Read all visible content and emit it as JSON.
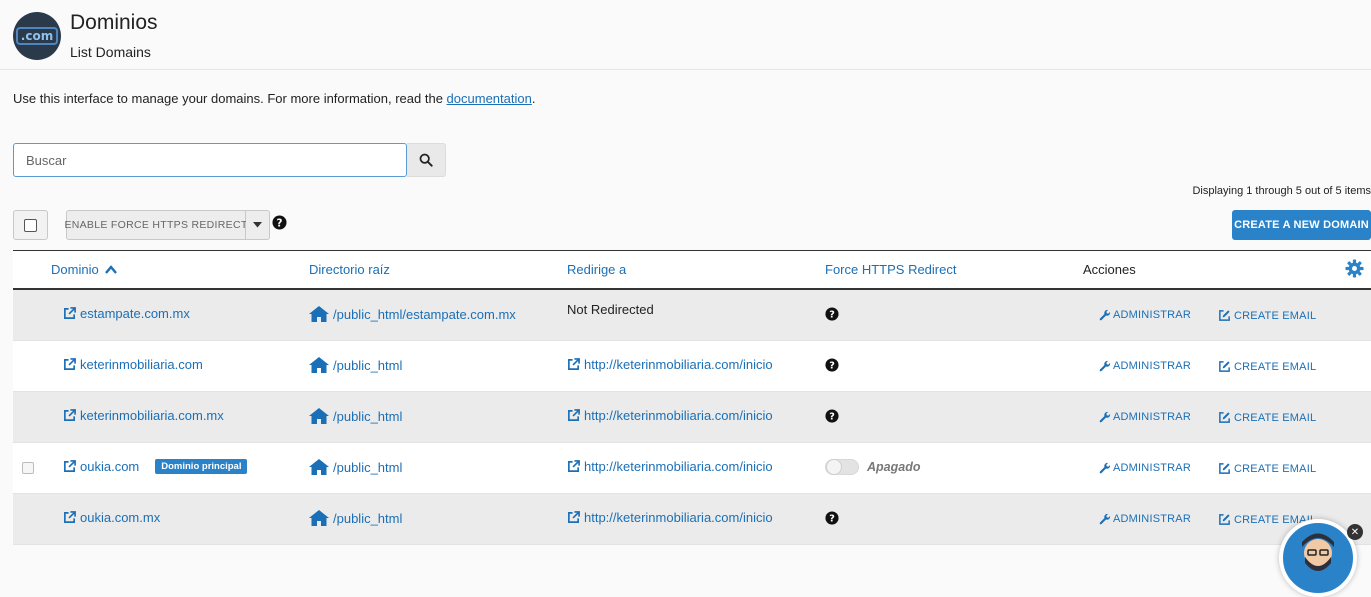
{
  "app": {
    "logo_text": ".com",
    "title": "Dominios",
    "subtitle": "List Domains"
  },
  "intro": {
    "text": "Use this interface to manage your domains. For more information, read the ",
    "link": "documentation",
    "suffix": "."
  },
  "search": {
    "placeholder": "Buscar",
    "value": ""
  },
  "pagination": {
    "displaying": "Displaying 1 through 5 out of 5 items"
  },
  "toolbar": {
    "https_button": "ENABLE FORCE HTTPS REDIRECT",
    "create_button": "CREATE A NEW DOMAIN"
  },
  "table": {
    "columns": {
      "domain": "Dominio",
      "docroot": "Directorio raíz",
      "redirect": "Redirige a",
      "force_https": "Force HTTPS Redirect",
      "actions": "Acciones"
    },
    "action_labels": {
      "manage": "ADMINISTRAR",
      "email": "CREATE EMAIL"
    },
    "rows": [
      {
        "domain": "estampate.com.mx",
        "docroot": "/public_html/estampate.com.mx",
        "redirect": "Not Redirected",
        "redirect_is_link": false,
        "https": "help",
        "primary": false
      },
      {
        "domain": "keterinmobiliaria.com",
        "docroot": "/public_html",
        "redirect": "http://keterinmobiliaria.com/inicio",
        "redirect_is_link": true,
        "https": "help",
        "primary": false
      },
      {
        "domain": "keterinmobiliaria.com.mx",
        "docroot": "/public_html",
        "redirect": "http://keterinmobiliaria.com/inicio",
        "redirect_is_link": true,
        "https": "help",
        "primary": false
      },
      {
        "domain": "oukia.com",
        "docroot": "/public_html",
        "redirect": "http://keterinmobiliaria.com/inicio",
        "redirect_is_link": true,
        "https": "toggle",
        "toggle_label": "Apagado",
        "primary": true,
        "primary_label": "Dominio principal"
      },
      {
        "domain": "oukia.com.mx",
        "docroot": "/public_html",
        "redirect": "http://keterinmobiliaria.com/inicio",
        "redirect_is_link": true,
        "https": "help",
        "primary": false
      }
    ]
  },
  "colors": {
    "accent": "#2a82c9",
    "link": "#1b6fb6",
    "row_alt": "#ebebeb"
  },
  "icons": [
    "search-icon",
    "caret-down-icon",
    "help-icon",
    "chevron-up-icon",
    "gear-icon",
    "external-link-icon",
    "home-icon",
    "wrench-icon",
    "edit-icon",
    "close-icon"
  ]
}
